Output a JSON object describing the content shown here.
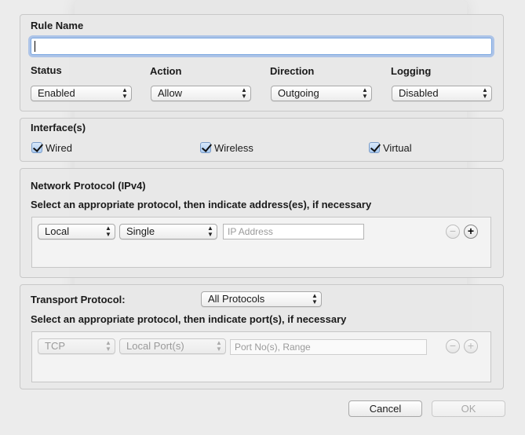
{
  "rule": {
    "name_label": "Rule Name",
    "name_value": "",
    "status_label": "Status",
    "status_value": "Enabled",
    "action_label": "Action",
    "action_value": "Allow",
    "direction_label": "Direction",
    "direction_value": "Outgoing",
    "logging_label": "Logging",
    "logging_value": "Disabled"
  },
  "interfaces": {
    "label": "Interface(s)",
    "items": [
      {
        "label": "Wired",
        "checked": true
      },
      {
        "label": "Wireless",
        "checked": true
      },
      {
        "label": "Virtual",
        "checked": true
      }
    ]
  },
  "network": {
    "title": "Network Protocol (IPv4)",
    "instruction": "Select an appropriate protocol, then indicate address(es), if necessary",
    "scope_value": "Local",
    "type_value": "Single",
    "address_placeholder": "IP Address"
  },
  "transport": {
    "label": "Transport Protocol:",
    "protocol_value": "All Protocols",
    "instruction": "Select an appropriate protocol, then indicate port(s), if necessary",
    "proto_value": "TCP",
    "port_type_value": "Local Port(s)",
    "port_placeholder": "Port No(s), Range"
  },
  "buttons": {
    "cancel": "Cancel",
    "ok": "OK"
  },
  "icons": {
    "popup_arrows": "up-down-arrows",
    "remove": "minus-circle",
    "add": "plus-circle",
    "check": "checkmark"
  }
}
